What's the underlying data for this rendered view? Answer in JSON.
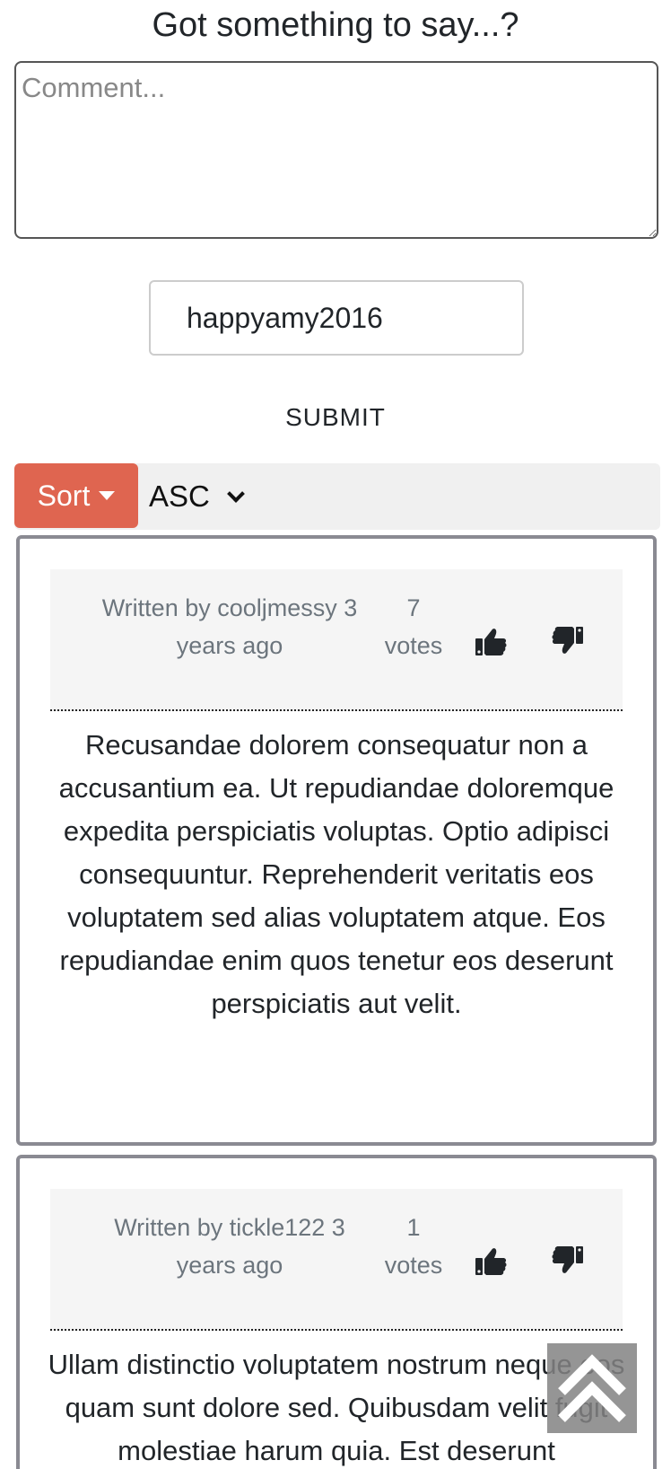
{
  "form": {
    "heading": "Got something to say...?",
    "comment_placeholder": "Comment...",
    "comment_value": "",
    "username_value": "happyamy2016",
    "submit_label": "SUBMIT"
  },
  "sort": {
    "button_label": "Sort",
    "order_selected": "ASC"
  },
  "comments": [
    {
      "author_line": "Written by cooljmessy 3 years ago",
      "votes_count": "7",
      "votes_label": "votes",
      "body": "Recusandae dolorem consequatur non a accusantium ea. Ut repudiandae doloremque expedita perspiciatis voluptas. Optio adipisci consequuntur. Reprehenderit veritatis eos voluptatem sed alias voluptatem atque. Eos repudiandae enim quos tenetur eos deserunt perspiciatis aut velit."
    },
    {
      "author_line": "Written by tickle122 3 years ago",
      "votes_count": "1",
      "votes_label": "votes",
      "body": "Ullam distinctio voluptatem nostrum neque eos quam sunt dolore sed. Quibusdam velit fugit molestiae harum quia. Est deserunt"
    }
  ],
  "icons": {
    "upvote": "thumbs-up-icon",
    "downvote": "thumbs-down-icon",
    "scroll_top": "double-chevron-up-icon",
    "sort_caret": "caret-down-icon",
    "select_chevron": "chevron-down-icon"
  },
  "colors": {
    "sort_button": "#df6550",
    "card_border": "#8a8a92",
    "meta_text": "#6c757d"
  }
}
